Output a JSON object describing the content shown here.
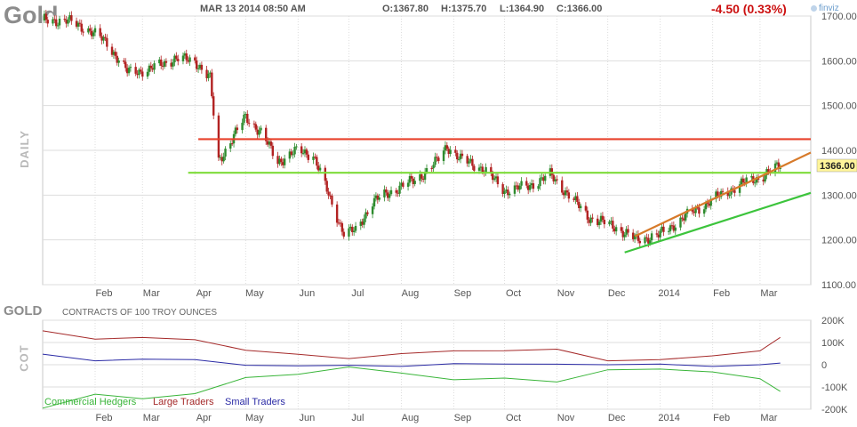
{
  "header": {
    "title": "Gold",
    "timestamp": "MAR 13 2014 08:50 AM",
    "open": "O:1367.80",
    "high": "H:1375.70",
    "low": "L:1364.90",
    "close": "C:1366.00",
    "change": "-4.50 (0.33%)",
    "brand": "finviz"
  },
  "price_panel": {
    "side_label": "DAILY",
    "last_price_label": "1366.00"
  },
  "cot_panel": {
    "title": "GOLD",
    "subtitle": "CONTRACTS OF 100 TROY OUNCES",
    "side_label": "COT",
    "legend": [
      "Commercial Hedgers",
      "Large Traders",
      "Small Traders"
    ]
  },
  "colors": {
    "up_candle": "#2e8b2e",
    "down_candle": "#b22222",
    "resistance": "#e8402a",
    "support": "#7edc3a",
    "channel_upper": "#d77a2a",
    "channel_lower": "#3cc43c",
    "commercial": "#39b539",
    "large": "#a52a2a",
    "small": "#2a2aa5",
    "grid": "#dddddd"
  },
  "chart_data": [
    {
      "type": "candlestick",
      "title": "Gold",
      "ylabel": "DAILY",
      "ylim": [
        1100,
        1700
      ],
      "yticks": [
        1100,
        1200,
        1300,
        1400,
        1500,
        1600,
        1700
      ],
      "ytick_labels": [
        "1100.00",
        "1200.00",
        "1300.00",
        "1400.00",
        "1500.00",
        "1600.00",
        "1700.00"
      ],
      "xticks": [
        "Feb",
        "Mar",
        "Apr",
        "May",
        "Jun",
        "Jul",
        "Aug",
        "Sep",
        "Oct",
        "Nov",
        "Dec",
        "2014",
        "Feb",
        "Mar"
      ],
      "close_path": {
        "x": [
          "2013-01-02",
          "2013-01-15",
          "2013-01-28",
          "2013-02-08",
          "2013-02-20",
          "2013-03-05",
          "2013-03-20",
          "2013-04-01",
          "2013-04-10",
          "2013-04-12",
          "2013-04-15",
          "2013-04-22",
          "2013-05-01",
          "2013-05-10",
          "2013-05-20",
          "2013-06-01",
          "2013-06-10",
          "2013-06-20",
          "2013-06-28",
          "2013-07-05",
          "2013-07-15",
          "2013-08-01",
          "2013-08-10",
          "2013-08-22",
          "2013-08-28",
          "2013-09-05",
          "2013-09-18",
          "2013-10-01",
          "2013-10-15",
          "2013-10-28",
          "2013-11-08",
          "2013-11-20",
          "2013-12-05",
          "2013-12-18",
          "2013-12-31",
          "2014-01-15",
          "2014-02-01",
          "2014-02-18",
          "2014-03-01",
          "2014-03-13"
        ],
        "values": [
          1690,
          1690,
          1670,
          1640,
          1575,
          1580,
          1605,
          1600,
          1560,
          1480,
          1375,
          1420,
          1475,
          1440,
          1375,
          1400,
          1390,
          1290,
          1215,
          1220,
          1285,
          1320,
          1335,
          1375,
          1410,
          1380,
          1360,
          1310,
          1320,
          1345,
          1300,
          1250,
          1230,
          1200,
          1210,
          1250,
          1290,
          1325,
          1340,
          1366
        ]
      },
      "lines": [
        {
          "name": "resistance",
          "x": [
            "2013-04-03",
            "2014-03-31"
          ],
          "y": [
            1425,
            1425
          ]
        },
        {
          "name": "support",
          "x": [
            "2013-03-28",
            "2014-03-31"
          ],
          "y": [
            1350,
            1350
          ]
        },
        {
          "name": "channel_upper",
          "x": [
            "2013-12-17",
            "2014-03-31"
          ],
          "y": [
            1208,
            1395
          ]
        },
        {
          "name": "channel_lower",
          "x": [
            "2013-12-11",
            "2014-03-31"
          ],
          "y": [
            1172,
            1305
          ]
        }
      ],
      "last_price": 1366.0
    },
    {
      "type": "line",
      "title": "GOLD",
      "ylabel": "COT",
      "ylim": [
        -200000,
        200000
      ],
      "yticks": [
        200000,
        100000,
        0,
        -100000,
        -200000
      ],
      "ytick_labels": [
        "200K",
        "100K",
        "0",
        "-100K",
        "-200K"
      ],
      "xticks": [
        "Feb",
        "Mar",
        "Apr",
        "May",
        "Jun",
        "Jul",
        "Aug",
        "Sep",
        "Oct",
        "Nov",
        "Dec",
        "2014",
        "Feb",
        "Mar"
      ],
      "x": [
        "2013-01-01",
        "2013-02-01",
        "2013-03-01",
        "2013-04-01",
        "2013-05-01",
        "2013-06-01",
        "2013-07-01",
        "2013-08-01",
        "2013-09-01",
        "2013-10-01",
        "2013-11-01",
        "2013-12-01",
        "2014-01-01",
        "2014-02-01",
        "2014-03-01",
        "2014-03-13"
      ],
      "series": [
        {
          "name": "Commercial Hedgers",
          "values": [
            -195000,
            -135000,
            -150000,
            -130000,
            -60000,
            -40000,
            -10000,
            -40000,
            -65000,
            -60000,
            -80000,
            -20000,
            -20000,
            -35000,
            -60000,
            -120000
          ]
        },
        {
          "name": "Large Traders",
          "values": [
            150000,
            115000,
            125000,
            110000,
            65000,
            50000,
            25000,
            50000,
            65000,
            60000,
            70000,
            20000,
            20000,
            40000,
            65000,
            120000
          ]
        },
        {
          "name": "Small Traders",
          "values": [
            45000,
            20000,
            25000,
            20000,
            0,
            -5000,
            -5000,
            -5000,
            5000,
            0,
            5000,
            0,
            0,
            -5000,
            0,
            5000
          ]
        }
      ]
    }
  ]
}
